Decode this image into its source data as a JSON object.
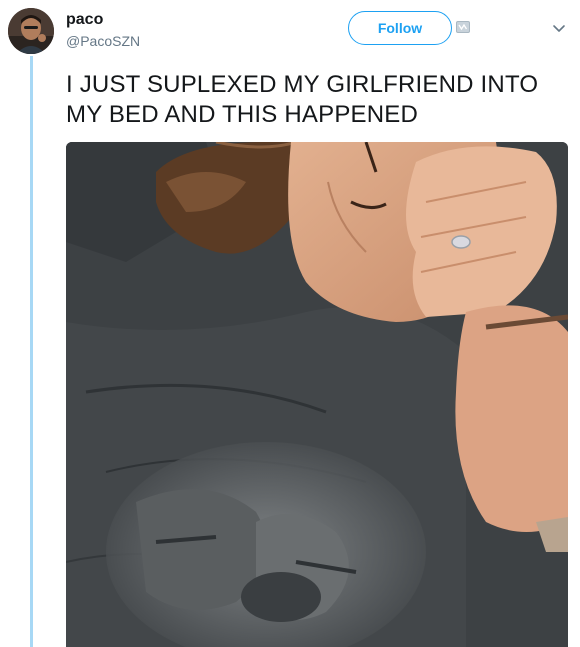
{
  "author": {
    "display_name": "paco",
    "screen_name": "@PacoSZN",
    "avatar_icon": "profile-avatar"
  },
  "actions": {
    "follow_label": "Follow",
    "follow_icon": "add-user-icon",
    "more_icon": "chevron-down-icon"
  },
  "tweet": {
    "text": "I JUST SUPLEXED MY GIRLFRIEND INTO MY BED AND THIS HAPPENED",
    "media_icon": "photo"
  },
  "colors": {
    "accent": "#1da1f2",
    "thread_line": "#a7d8f5",
    "text_primary": "#14171a",
    "text_secondary": "#657786"
  }
}
